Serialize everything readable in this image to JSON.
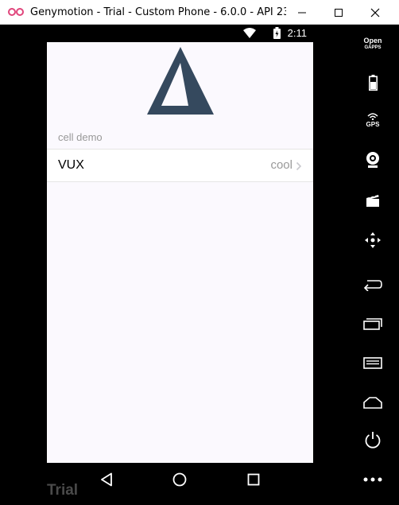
{
  "window": {
    "title": "Genymotion - Trial - Custom Phone - 6.0.0 - API 23 - ...",
    "minimize_label": "minimize",
    "maximize_label": "maximize",
    "close_label": "close"
  },
  "status_bar": {
    "time": "2:11"
  },
  "app": {
    "group_title": "cell demo",
    "cell": {
      "title": "VUX",
      "value": "cool"
    }
  },
  "sidebar": {
    "opengapps_line1": "Open",
    "opengapps_line2": "GAPPS",
    "gps_label": "GPS"
  },
  "watermark": "Trial",
  "colors": {
    "logo": "#35495e",
    "screen_bg": "#fbf9fe",
    "muted_text": "#999999"
  }
}
